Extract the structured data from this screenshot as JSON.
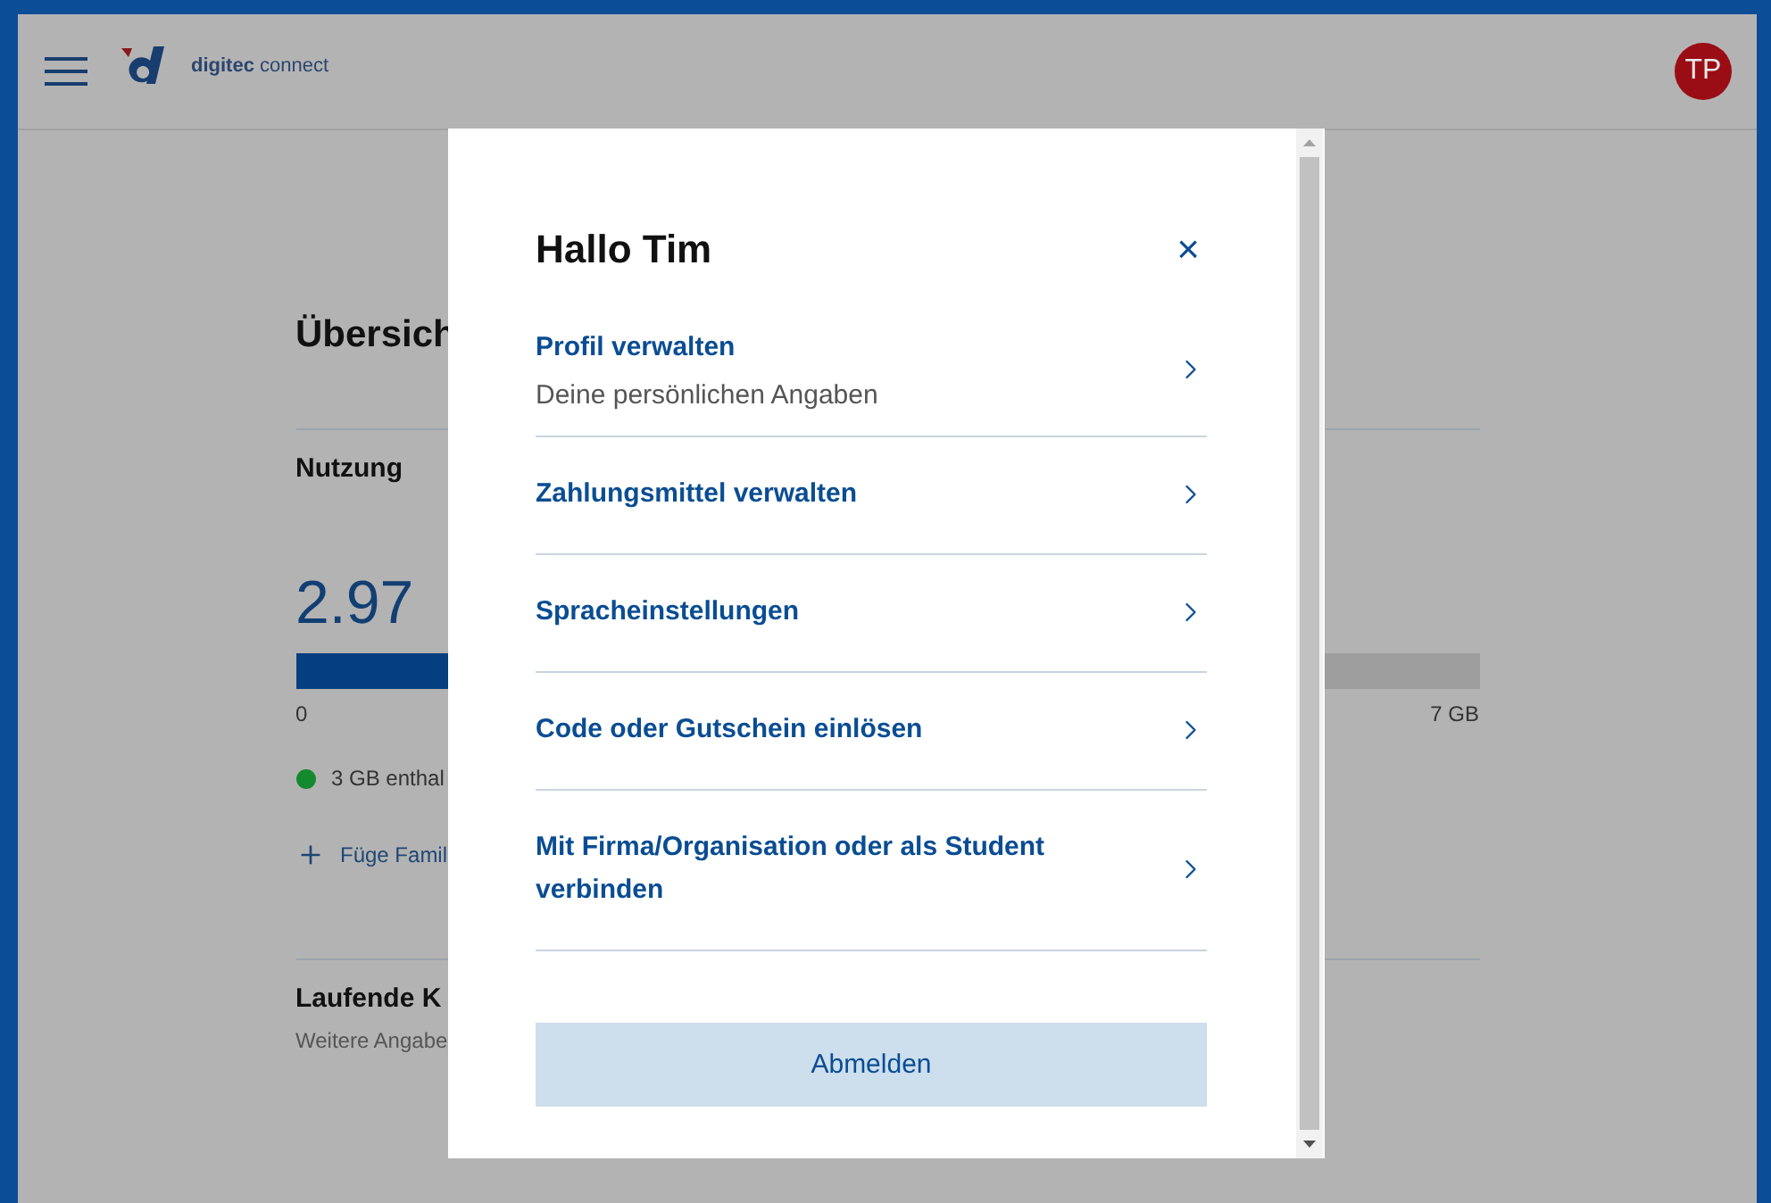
{
  "header": {
    "brand": "digitec",
    "brand_suffix": "connect",
    "avatar": "TP"
  },
  "page": {
    "title": "Übersich",
    "usage_label": "Nutzung",
    "usage_value": "2.97",
    "usage": {
      "level": 0.42,
      "min": "0",
      "max": "7 GB"
    },
    "included": {
      "text": "3 GB enthal",
      "color": "#138a2e"
    },
    "add_family": "Füge Famil",
    "running_costs": "Laufende K",
    "more_info": "Weitere Angabe"
  },
  "dialog": {
    "title": "Hallo Tim",
    "close": "×",
    "items": [
      {
        "label": "Profil verwalten",
        "subtitle": "Deine persönlichen Angaben"
      },
      {
        "label": "Zahlungsmittel verwalten"
      },
      {
        "label": "Spracheinstellungen"
      },
      {
        "label": "Code oder Gutschein einlösen"
      },
      {
        "label": "Mit Firma/Organisation oder als Student verbinden"
      }
    ],
    "logout": "Abmelden"
  }
}
